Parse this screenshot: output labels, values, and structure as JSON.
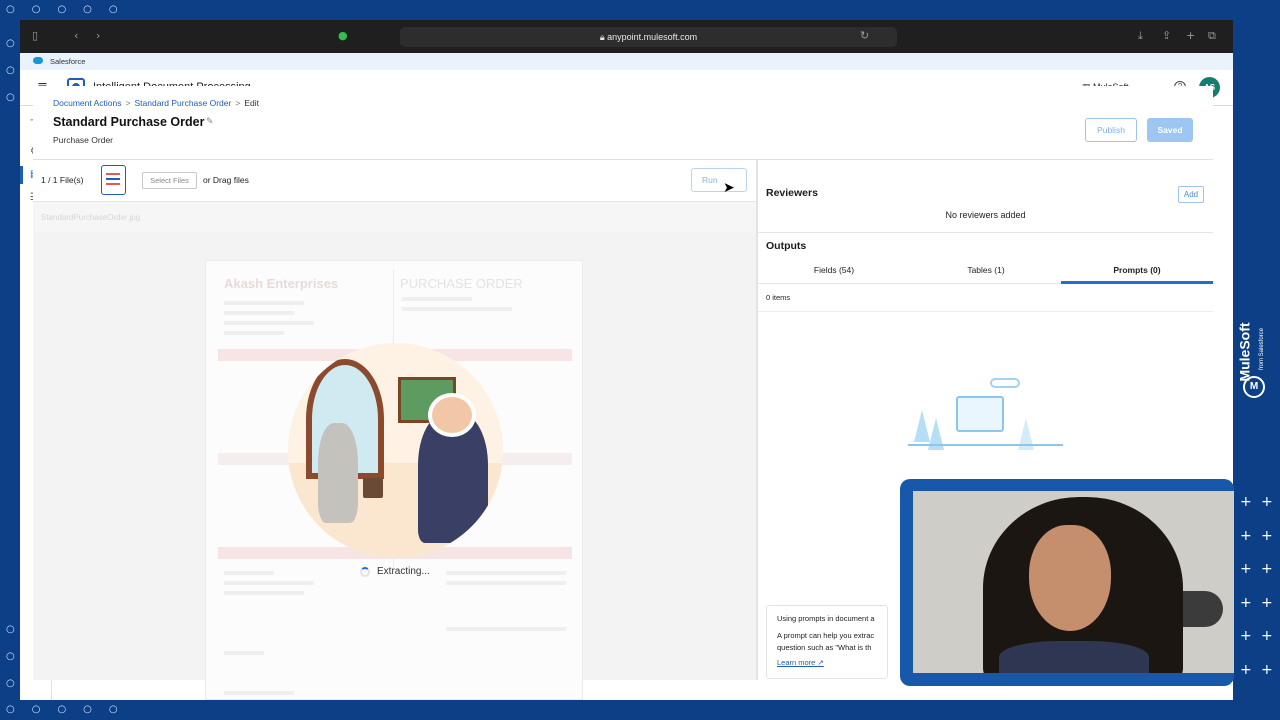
{
  "browser": {
    "url": "anypoint.mulesoft.com",
    "bookmark": "Salesforce"
  },
  "app": {
    "title": "Intelligent Document Processing",
    "org": "MuleSoft",
    "avatar_initials": "AS",
    "avatar_color": "#147d6f",
    "accent_color": "#1e5fb3"
  },
  "breadcrumb": {
    "item1": "Document Actions",
    "item2": "Standard Purchase Order",
    "current": "Edit"
  },
  "page": {
    "title": "Standard Purchase Order",
    "subtitle": "Purchase Order",
    "publish_label": "Publish",
    "saved_label": "Saved"
  },
  "toolbar": {
    "file_count": "1 / 1 File(s)",
    "select_files_label": "Select Files",
    "drag_text": "or Drag files",
    "run_label": "Run"
  },
  "preview": {
    "file_name": "StandardPurchaseOrder.jpg",
    "company": "Akash Enterprises",
    "doc_heading": "PURCHASE ORDER",
    "status_text": "Extracting..."
  },
  "reviewers": {
    "title": "Reviewers",
    "add_label": "Add",
    "empty_text": "No reviewers added"
  },
  "outputs": {
    "title": "Outputs",
    "tabs": [
      {
        "label": "Fields (54)",
        "active": false
      },
      {
        "label": "Tables (1)",
        "active": false
      },
      {
        "label": "Prompts (0)",
        "active": true
      }
    ],
    "items_count": "0 items",
    "tip_title": "Using prompts in document a",
    "tip_line1": "A prompt can help you extrac",
    "tip_line2": "question such as \"What is th",
    "learn_more": "Learn more"
  },
  "brand": {
    "name": "MuleSoft",
    "from": "from Salesforce"
  },
  "icons": {
    "sidebar": [
      "arrow-right-icon",
      "gear-icon",
      "document-icon",
      "list-icon"
    ],
    "browser": [
      "sidebar-toggle-icon",
      "back-icon",
      "forward-icon",
      "reload-icon",
      "download-icon",
      "share-icon",
      "new-tab-icon",
      "tabs-icon"
    ]
  }
}
